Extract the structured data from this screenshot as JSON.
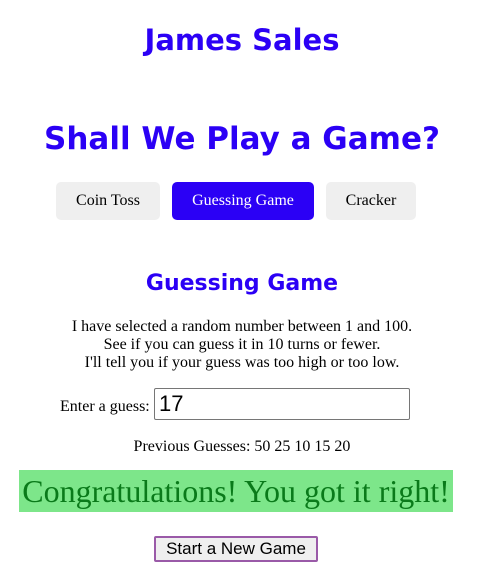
{
  "header": {
    "author": "James Sales",
    "tagline": "Shall We Play a Game?"
  },
  "nav": {
    "items": [
      {
        "label": "Coin Toss",
        "active": false
      },
      {
        "label": "Guessing Game",
        "active": true
      },
      {
        "label": "Cracker",
        "active": false
      }
    ]
  },
  "game": {
    "title": "Guessing Game",
    "instructions": [
      "I have selected a random number between 1 and 100.",
      "See if you can guess it in 10 turns or fewer.",
      "I'll tell you if your guess was too high or too low."
    ],
    "guess_label": "Enter a guess:",
    "guess_value": "17",
    "previous_guesses": "Previous Guesses: 50 25 10 15 20",
    "result_message": "Congratulations! You got it right!",
    "new_game_label": "Start a New Game"
  },
  "colors": {
    "accent": "#2b00f5",
    "tab_inactive": "#efefef",
    "result_bg": "#7de68a",
    "result_text": "#0a7a1a",
    "new_game_border": "#9a5aa8"
  }
}
